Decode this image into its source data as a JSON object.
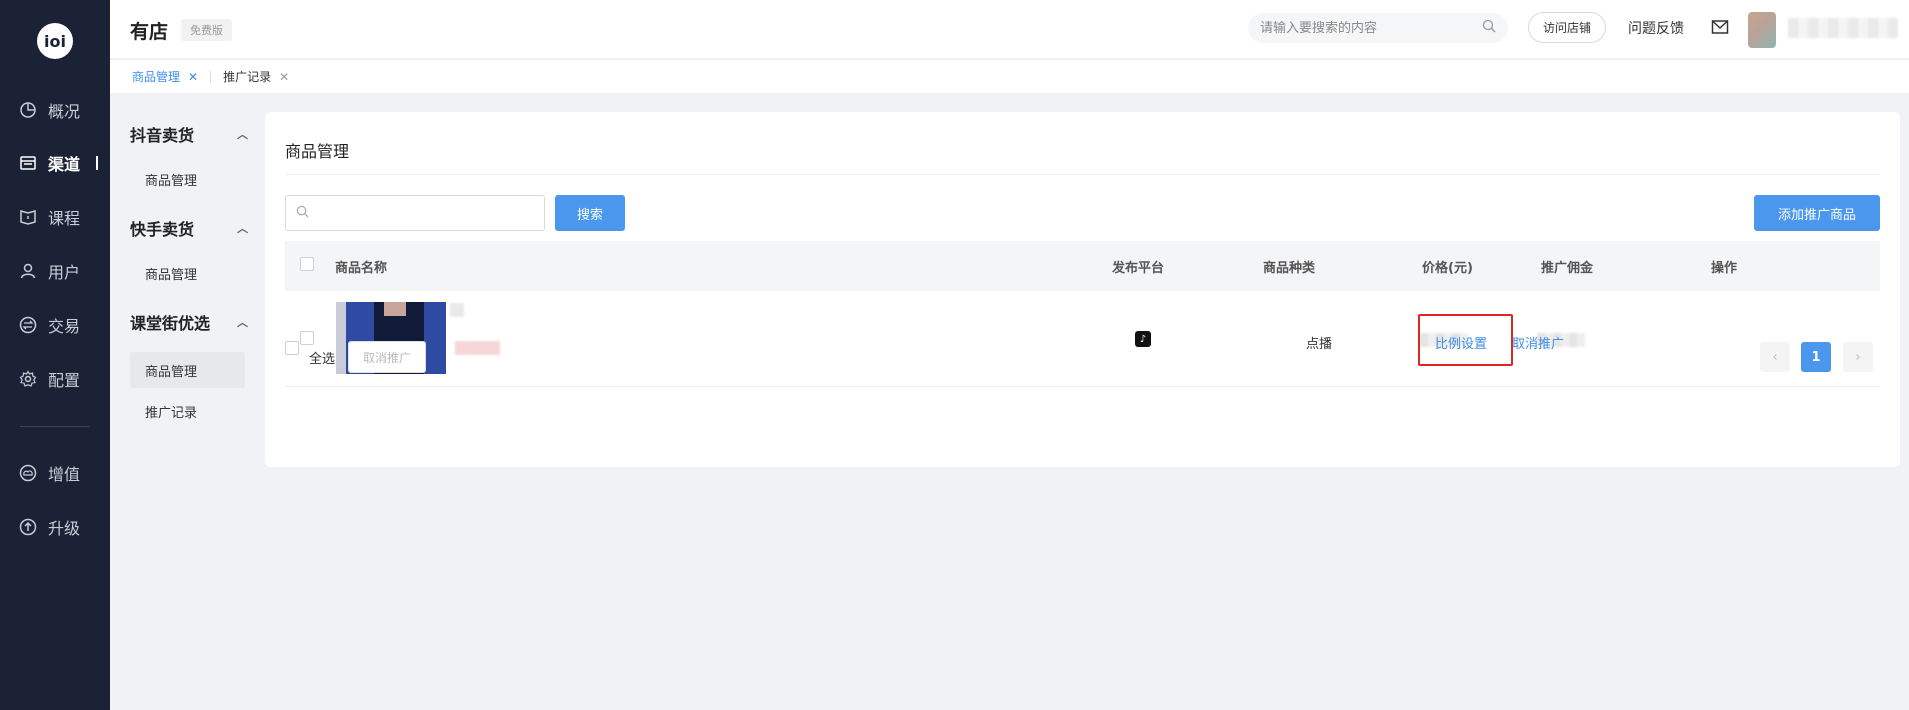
{
  "logo": {
    "text": "ioi"
  },
  "nav": {
    "items": [
      {
        "label": "概况",
        "icon": "pie-chart-icon"
      },
      {
        "label": "渠道",
        "icon": "store-icon",
        "active": true
      },
      {
        "label": "课程",
        "icon": "book-icon"
      },
      {
        "label": "用户",
        "icon": "user-icon"
      },
      {
        "label": "交易",
        "icon": "exchange-icon"
      },
      {
        "label": "配置",
        "icon": "gear-icon"
      },
      {
        "label": "增值",
        "icon": "cloud-icon"
      },
      {
        "label": "升级",
        "icon": "arrow-up-icon"
      }
    ]
  },
  "header": {
    "brand": "有店",
    "badge": "免费版",
    "search_placeholder": "请输入要搜索的内容",
    "visit_store": "访问店铺",
    "feedback": "问题反馈"
  },
  "tabs": [
    {
      "label": "商品管理",
      "active": true
    },
    {
      "label": "推广记录",
      "active": false
    }
  ],
  "subnav": {
    "groups": [
      {
        "title": "抖音卖货",
        "items": [
          "商品管理"
        ]
      },
      {
        "title": "快手卖货",
        "items": [
          "商品管理"
        ]
      },
      {
        "title": "课堂街优选",
        "items": [
          "商品管理",
          "推广记录"
        ]
      }
    ]
  },
  "main": {
    "title": "商品管理",
    "search_button": "搜索",
    "add_button": "添加推广商品",
    "columns": [
      "商品名称",
      "发布平台",
      "商品种类",
      "价格(元)",
      "推广佣金",
      "操作"
    ],
    "rows": [
      {
        "platform_icon": "tiktok-icon",
        "type": "点播",
        "actions": [
          "比例设置",
          "取消推广"
        ]
      }
    ],
    "select_all": "全选",
    "bulk_cancel": "取消推广",
    "page": "1"
  },
  "colors": {
    "accent": "#4a97ed",
    "sidebar": "#1b2236",
    "highlight": "#e02424"
  }
}
